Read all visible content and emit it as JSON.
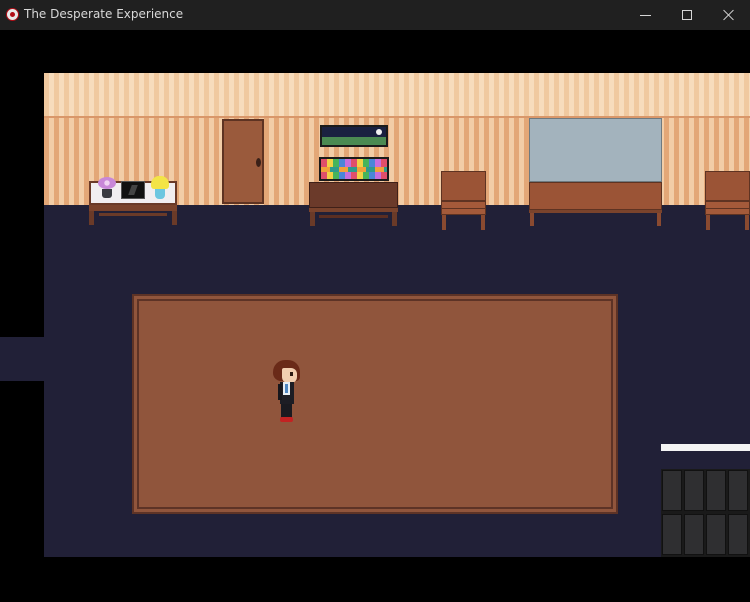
{
  "window": {
    "title": "The Desperate Experience",
    "icon": "app-eye-icon",
    "controls": {
      "minimize": "minimize-icon",
      "maximize": "maximize-icon",
      "close": "close-icon"
    }
  },
  "scene": {
    "colors": {
      "floor": "#212037",
      "rug": "#90553c",
      "rug_border": "#5d3326",
      "wall_stripe_dark": "#e3a777",
      "wall_stripe_light": "#f2cda7",
      "wood": "#9b5436",
      "board": "#a3b3bd"
    }
  }
}
